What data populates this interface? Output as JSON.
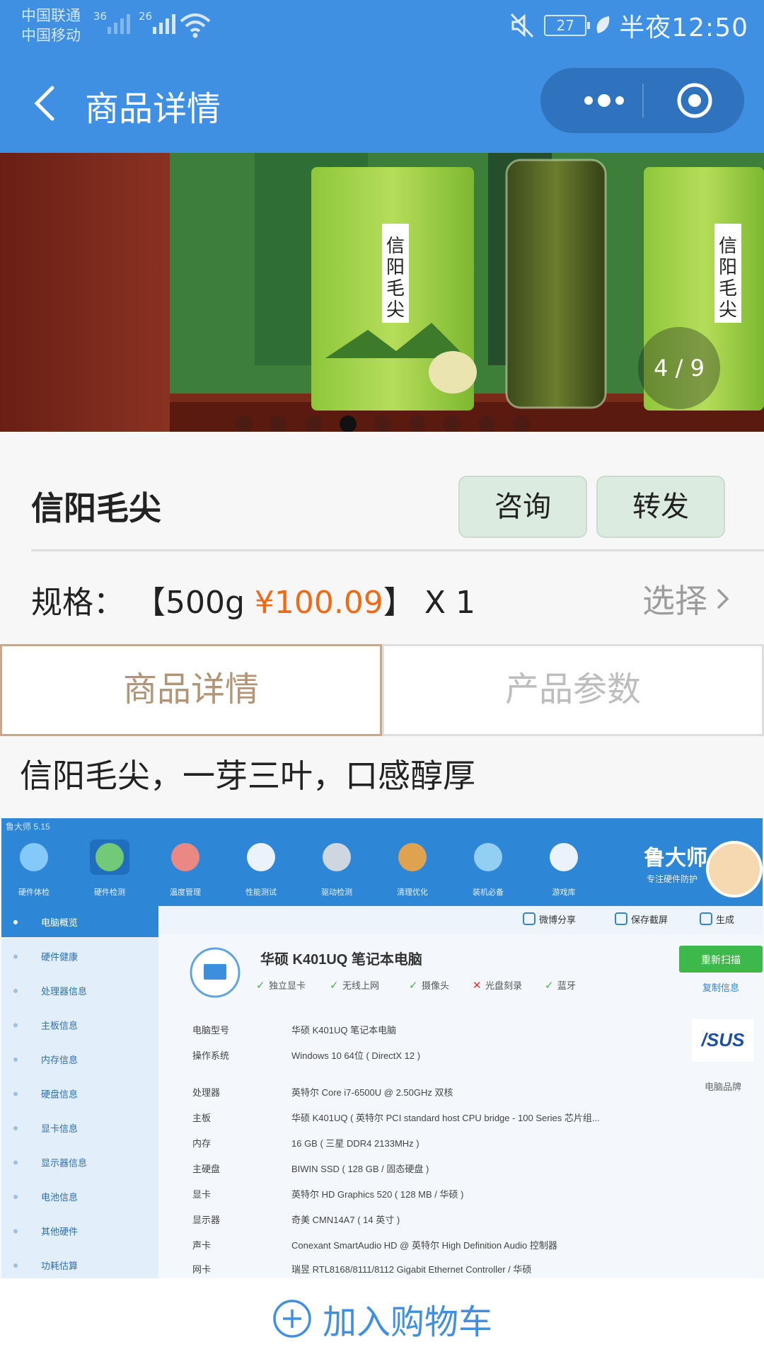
{
  "status_bar": {
    "carrier_1": "中国联通",
    "carrier_2": "中国移动",
    "sim1_network": "36",
    "sim2_network": "26",
    "battery": "27",
    "time": "半夜12:50"
  },
  "nav": {
    "title": "商品详情"
  },
  "gallery": {
    "counter": "4 / 9",
    "current_index": 4,
    "total": 9
  },
  "product": {
    "name": "信阳毛尖",
    "consult_label": "咨询",
    "share_label": "转发"
  },
  "spec": {
    "label": "规格：",
    "open": "【500g ",
    "price": "¥100.09",
    "close": "】 X 1",
    "choose_label": "选择"
  },
  "tabs": {
    "details": "商品详情",
    "params": "产品参数"
  },
  "description": "信阳毛尖，一芽三叶，口感醇厚",
  "screenshot": {
    "app_title": "鲁大师 5.15",
    "brand": "鲁大师",
    "brand_sub": "专注硬件防护",
    "toolbar_items": [
      "硬件体检",
      "硬件检测",
      "温度管理",
      "性能测试",
      "驱动检测",
      "清理优化",
      "装机必备",
      "游戏库"
    ],
    "side_menu": [
      "电脑概览",
      "硬件健康",
      "处理器信息",
      "主板信息",
      "内存信息",
      "硬盘信息",
      "显卡信息",
      "显示器信息",
      "电池信息",
      "其他硬件",
      "功耗估算"
    ],
    "actions": [
      "微博分享",
      "保存截屏",
      "生成"
    ],
    "device_title": "华硕 K401UQ 笔记本电脑",
    "features": [
      "独立显卡",
      "无线上网",
      "摄像头",
      "光盘刻录",
      "蓝牙"
    ],
    "rescan_label": "重新扫描",
    "copy_label": "复制信息",
    "vendor_logo": "/SUS",
    "vendor_label": "电脑品牌",
    "specs": [
      {
        "key": "电脑型号",
        "value": "华硕 K401UQ 笔记本电脑"
      },
      {
        "key": "操作系统",
        "value": "Windows 10 64位 ( DirectX 12 )"
      },
      {
        "key": "处理器",
        "value": "英特尔 Core i7-6500U @ 2.50GHz 双核"
      },
      {
        "key": "主板",
        "value": "华硕 K401UQ ( 英特尔 PCI standard host CPU bridge - 100 Series 芯片组..."
      },
      {
        "key": "内存",
        "value": "16 GB ( 三星 DDR4 2133MHz )"
      },
      {
        "key": "主硬盘",
        "value": "BIWIN SSD ( 128 GB / 固态硬盘 )"
      },
      {
        "key": "显卡",
        "value": "英特尔 HD Graphics 520 ( 128 MB / 华硕 )"
      },
      {
        "key": "显示器",
        "value": "奇美 CMN14A7 ( 14 英寸 )"
      },
      {
        "key": "声卡",
        "value": "Conexant SmartAudio HD @ 英特尔 High Definition Audio 控制器"
      },
      {
        "key": "网卡",
        "value": "瑞昱 RTL8168/8111/8112 Gigabit Ethernet Controller / 华硕"
      }
    ]
  },
  "cart": {
    "label": "加入购物车"
  },
  "colors": {
    "nav_blue": "#3f8fe2",
    "price_orange": "#f06a16",
    "tab_active": "#b29575",
    "button_green": "#dcebdf"
  }
}
